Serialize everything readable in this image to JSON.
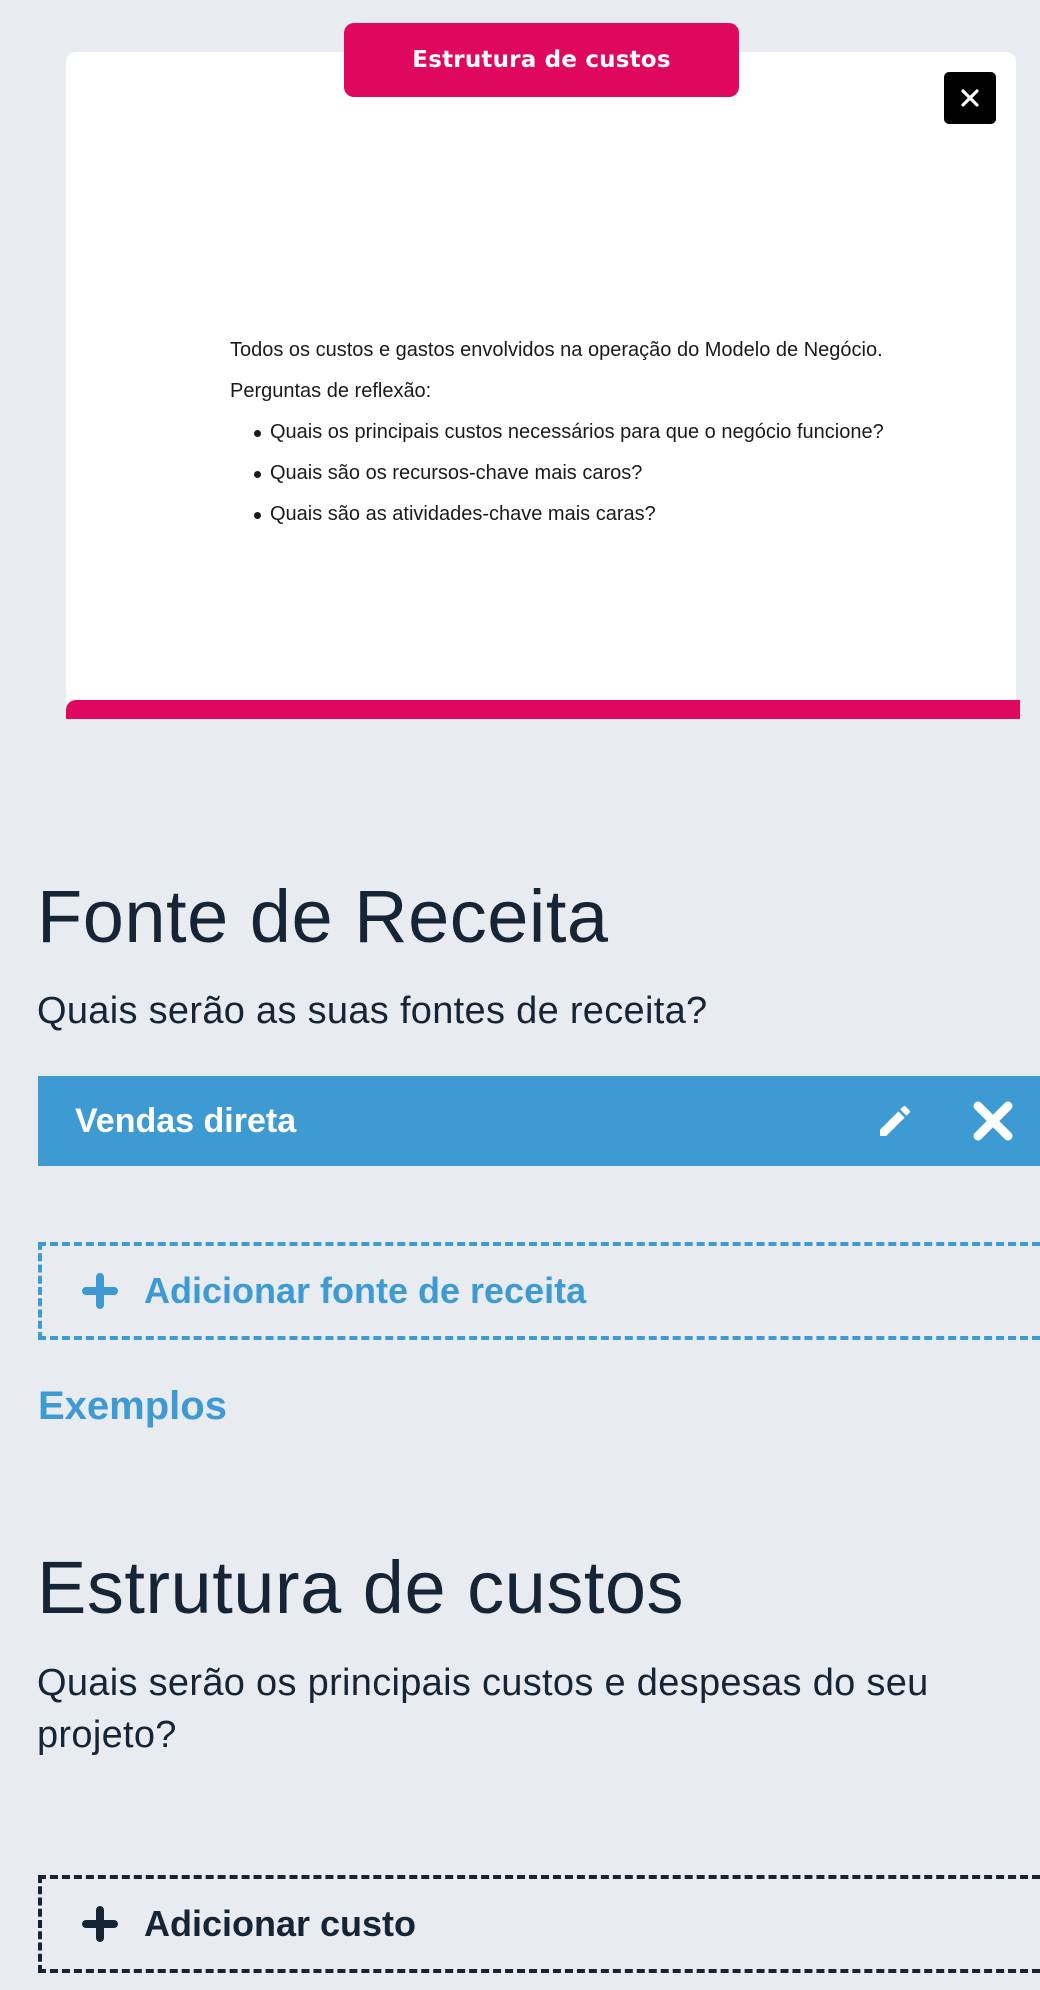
{
  "modal": {
    "title": "Estrutura de custos",
    "close_icon": "close-icon",
    "description": "Todos os custos e gastos envolvidos na operação do Modelo de Negócio.",
    "reflection_heading": "Perguntas de reflexão:",
    "questions": [
      "Quais os principais custos necessários para que o negócio funcione?",
      "Quais são os recursos-chave mais caros?",
      "Quais são as atividades-chave mais caras?"
    ],
    "accent_color": "#e0085e"
  },
  "revenue": {
    "title": "Fonte de Receita",
    "question": "Quais serão as suas fontes de receita?",
    "items": [
      {
        "label": "Vendas direta",
        "edit_icon": "pencil-icon",
        "delete_icon": "close-icon"
      }
    ],
    "add_label": "Adicionar fonte de receita",
    "examples_label": "Exemplos",
    "accent_color": "#3d9ad3"
  },
  "costs": {
    "title": "Estrutura de custos",
    "question": "Quais serão os principais custos e despesas do seu projeto?",
    "add_label": "Adicionar custo"
  }
}
